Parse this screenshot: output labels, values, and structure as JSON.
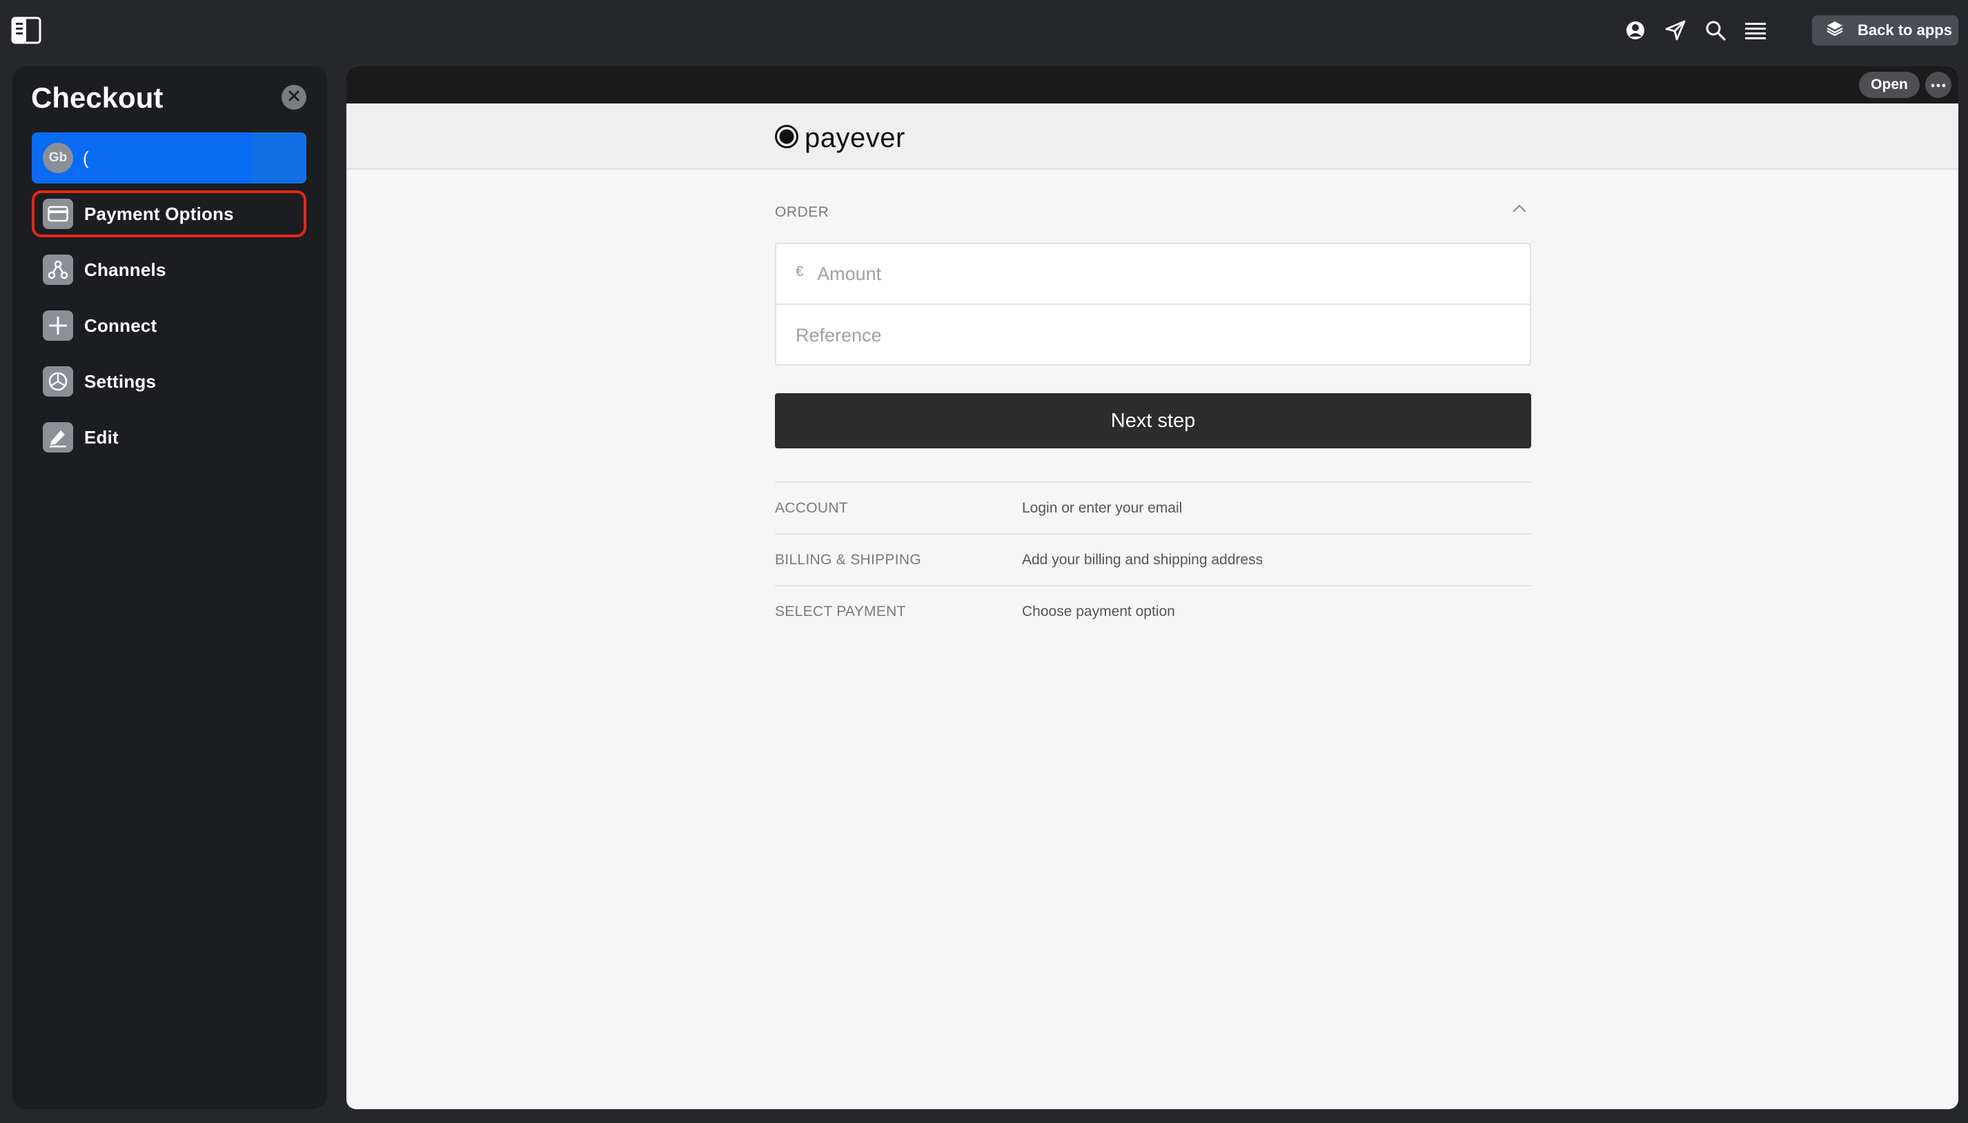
{
  "topbar": {
    "back_to_apps_label": "Back to apps",
    "icons": [
      "profile-icon",
      "send-icon",
      "search-icon",
      "menu-icon"
    ]
  },
  "sidebar": {
    "title": "Checkout",
    "business": {
      "initials": "Gb",
      "name": "("
    },
    "items": [
      {
        "label": "Payment Options",
        "icon": "card-icon",
        "highlighted": true
      },
      {
        "label": "Channels",
        "icon": "channels-icon"
      },
      {
        "label": "Connect",
        "icon": "plus-icon"
      },
      {
        "label": "Settings",
        "icon": "settings-icon"
      },
      {
        "label": "Edit",
        "icon": "edit-icon"
      }
    ]
  },
  "main": {
    "open_label": "Open",
    "logo_text": "payever",
    "order": {
      "title": "ORDER",
      "currency": "€",
      "amount_placeholder": "Amount",
      "reference_placeholder": "Reference"
    },
    "next_button": "Next step",
    "steps": [
      {
        "name": "ACCOUNT",
        "desc": "Login or enter your email"
      },
      {
        "name": "BILLING & SHIPPING",
        "desc": "Add your billing and shipping address"
      },
      {
        "name": "SELECT PAYMENT",
        "desc": "Choose payment option"
      }
    ]
  },
  "colors": {
    "background": "#25272b",
    "sidebar": "#1c1d20",
    "accent_blue": "#0a6bf5",
    "highlight_red": "#e3281b",
    "button_dark": "#2c2c2c"
  }
}
